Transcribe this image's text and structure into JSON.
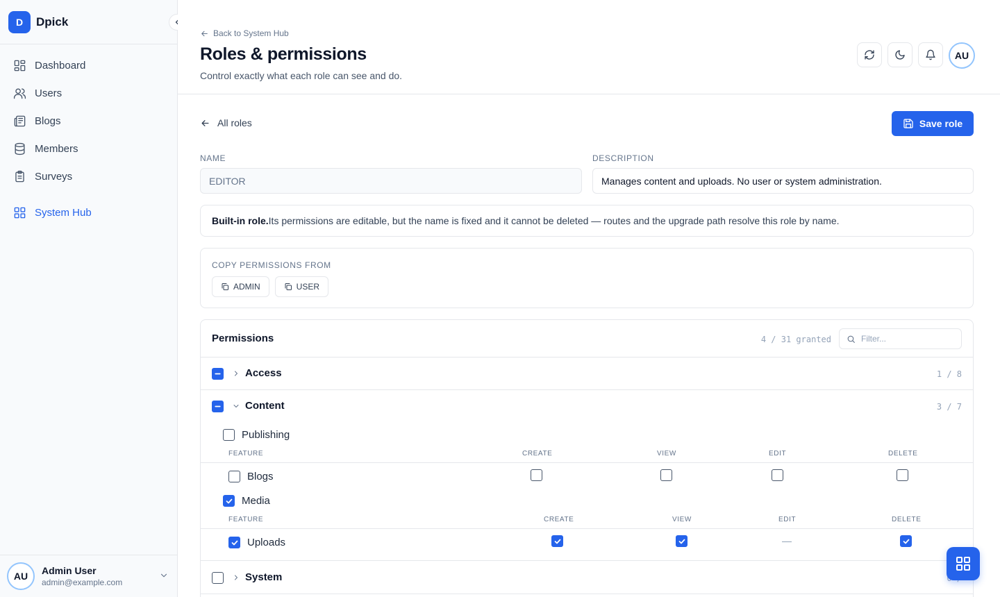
{
  "app": {
    "brand_initial": "D",
    "brand_name": "Dpick"
  },
  "sidebar": {
    "items": [
      {
        "label": "Dashboard",
        "icon": "dashboard-icon"
      },
      {
        "label": "Users",
        "icon": "users-icon"
      },
      {
        "label": "Blogs",
        "icon": "blogs-icon"
      },
      {
        "label": "Members",
        "icon": "database-icon"
      },
      {
        "label": "Surveys",
        "icon": "clipboard-icon"
      }
    ],
    "active_item": {
      "label": "System Hub",
      "icon": "grid-icon"
    },
    "user": {
      "initials": "AU",
      "name": "Admin User",
      "email": "admin@example.com"
    }
  },
  "header": {
    "back_label": "Back to System Hub",
    "title": "Roles & permissions",
    "subtitle": "Control exactly what each role can see and do.",
    "avatar_initials": "AU"
  },
  "editor": {
    "all_roles_label": "All roles",
    "save_label": "Save role",
    "name_label": "NAME",
    "name_value": "EDITOR",
    "description_label": "DESCRIPTION",
    "description_value": "Manages content and uploads. No user or system administration.",
    "notice_bold": "Built-in role.",
    "notice_text": "Its permissions are editable, but the name is fixed and it cannot be deleted — routes and the upgrade path resolve this role by name.",
    "copy_label": "COPY PERMISSIONS FROM",
    "copy_options": [
      "ADMIN",
      "USER"
    ]
  },
  "permissions": {
    "title": "Permissions",
    "granted": "4 / 31 granted",
    "filter_placeholder": "Filter...",
    "groups": [
      {
        "name": "Access",
        "count": "1 / 8",
        "state": "indeterminate"
      },
      {
        "name": "Content",
        "count": "3 / 7",
        "state": "indeterminate"
      },
      {
        "name": "System",
        "count": "0 / ",
        "state": "unchecked"
      }
    ],
    "subgroups": [
      {
        "name": "Publishing",
        "checked": false,
        "headers": [
          "FEATURE",
          "CREATE",
          "VIEW",
          "EDIT",
          "DELETE"
        ],
        "features": [
          {
            "name": "Blogs",
            "checked": false,
            "create": false,
            "view": false,
            "edit": false,
            "delete": false
          }
        ]
      },
      {
        "name": "Media",
        "checked": true,
        "headers": [
          "FEATURE",
          "CREATE",
          "VIEW",
          "EDIT",
          "DELETE"
        ],
        "features": [
          {
            "name": "Uploads",
            "checked": true,
            "create": true,
            "view": true,
            "edit": "n/a",
            "delete": true
          }
        ]
      }
    ]
  },
  "colors": {
    "accent": "#2563eb",
    "border": "#e5e7eb",
    "muted": "#64748b"
  }
}
